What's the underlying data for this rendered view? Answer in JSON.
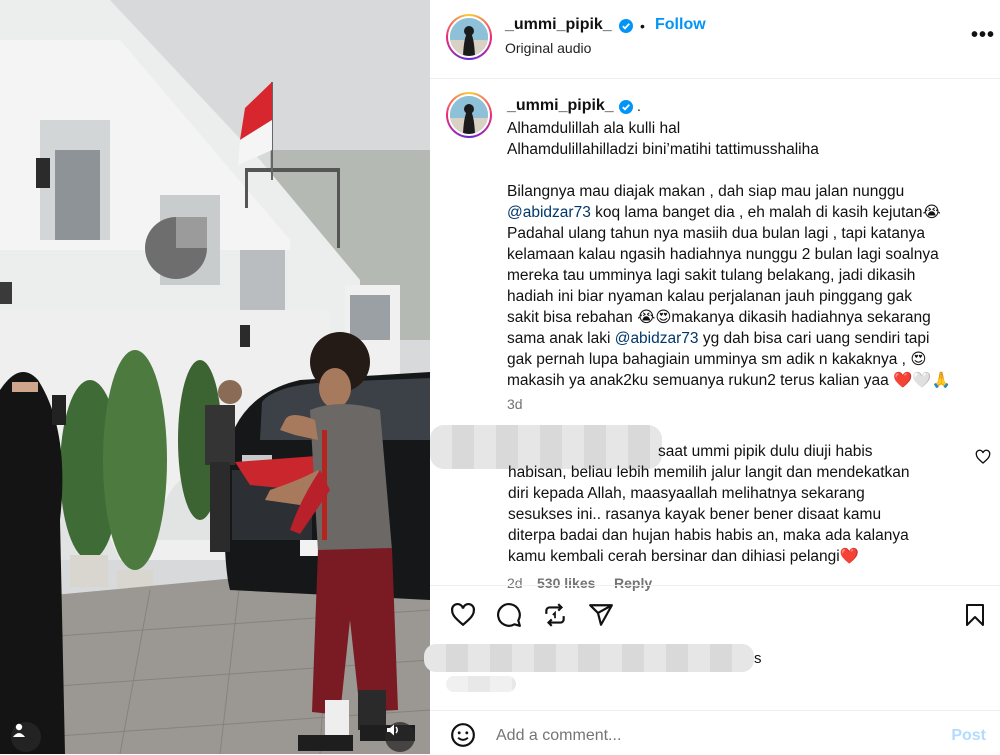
{
  "header": {
    "username": "_ummi_pipik_",
    "separator": "•",
    "follow_label": "Follow",
    "audio_label": "Original audio",
    "more_label": "•••"
  },
  "caption": {
    "username": "_ummi_pipik_",
    "trailing_dot": ".",
    "lines": [
      "Alhamdulillah ala kulli hal",
      "Alhamdulillahilladzi bini’matihi tattimusshaliha",
      "",
      "Bilangnya mau diajak makan , dah siap mau jalan nunggu",
      "@abidzar73 koq lama banget dia , eh malah di kasih kejutan😭",
      "Padahal ulang tahun nya masiih dua bulan lagi , tapi katanya",
      "kelamaan kalau ngasih hadiahnya nunggu 2 bulan lagi soalnya",
      "mereka tau umminya lagi sakit tulang belakang, jadi dikasih",
      "hadiah ini biar nyaman kalau perjalanan jauh pinggang gak",
      "sakit bisa rebahan 😭😍makanya dikasih hadiahnya sekarang",
      "sama anak laki @abidzar73 yg dah bisa cari uang sendiri tapi",
      "gak pernah lupa bahagiain umminya sm adik n kakaknya , 😍",
      "makasih ya anak2ku semuanya rukun2 terus kalian yaa ❤️🤍🙏"
    ],
    "time": "3d"
  },
  "comment": {
    "lines": [
      "saat ummi pipik dulu diuji habis",
      "habisan, beliau lebih memilih jalur langit dan mendekatkan",
      "diri kepada Allah, maasyaallah melihatnya sekarang",
      "sesukses ini.. rasanya kayak bener bener disaat kamu",
      "diterpa badai dan hujan habis habis an, maka ada kalanya",
      "kamu kembali cerah bersinar dan dihiasi pelangi❤️"
    ],
    "time": "2d",
    "likes": "530 likes",
    "reply": "Reply"
  },
  "likes_row": {
    "suffix": "s"
  },
  "add_comment": {
    "placeholder": "Add a comment...",
    "post_label": "Post"
  },
  "colors": {
    "accent": "#0095f6",
    "post_disabled": "#b3dbff",
    "muted": "#737373",
    "mention": "#00376b",
    "like_heart": "#ed4956"
  },
  "icons": [
    "verified-badge-icon",
    "more-options-icon",
    "heart-icon",
    "comment-icon",
    "repost-icon",
    "share-icon",
    "bookmark-icon",
    "emoji-icon",
    "audio-icon",
    "user-tag-icon"
  ]
}
